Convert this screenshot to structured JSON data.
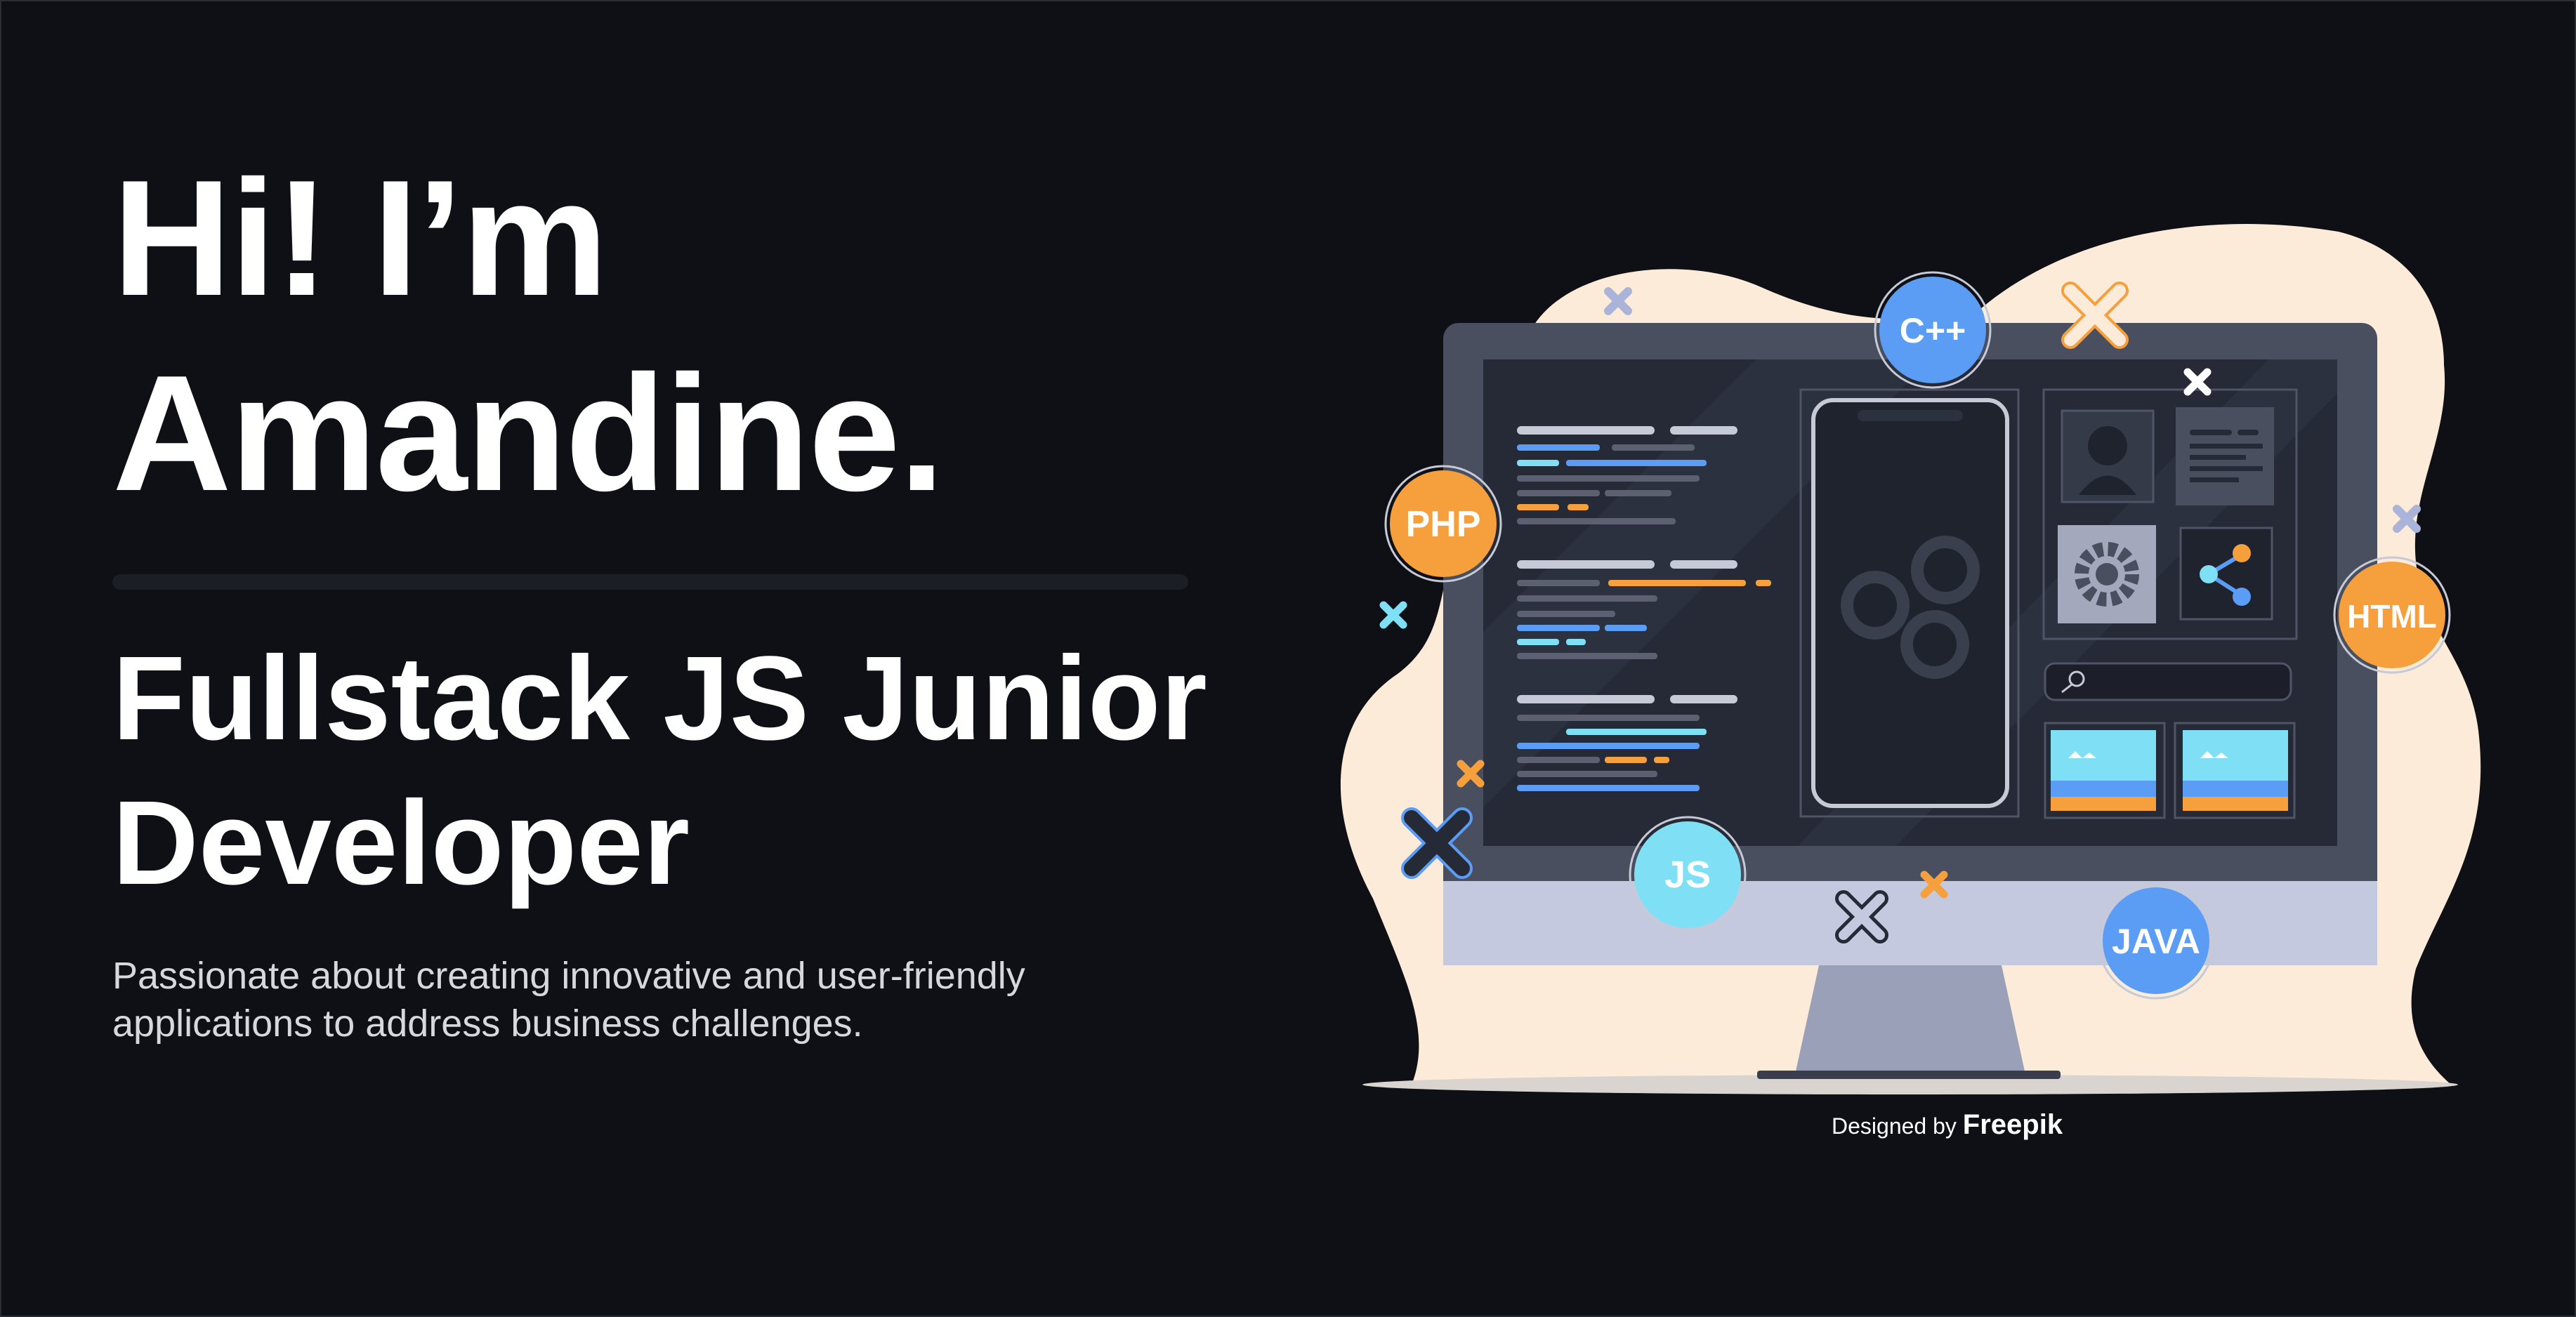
{
  "hero": {
    "headline_line1": "Hi! I’m",
    "headline_line2": "Amandine.",
    "role_line1": "Fullstack JS Junior",
    "role_line2": "Developer",
    "tagline_line1": "Passionate about creating innovative and user-friendly",
    "tagline_line2": "applications to address business challenges."
  },
  "illustration": {
    "badges": {
      "cpp": "C++",
      "php": "PHP",
      "html": "HTML",
      "js": "JS",
      "java": "JAVA"
    }
  },
  "credit": {
    "prefix": "Designed by",
    "brand": "Freepik"
  },
  "colors": {
    "background": "#0e1015",
    "blob": "#fcebd9",
    "monitor_frame": "#4a4f60",
    "screen": "#262a36",
    "bezel_bottom": "#c4c9df",
    "orange": "#f59f3d",
    "blue": "#5b9cf5",
    "cyan": "#7fe0f5"
  }
}
